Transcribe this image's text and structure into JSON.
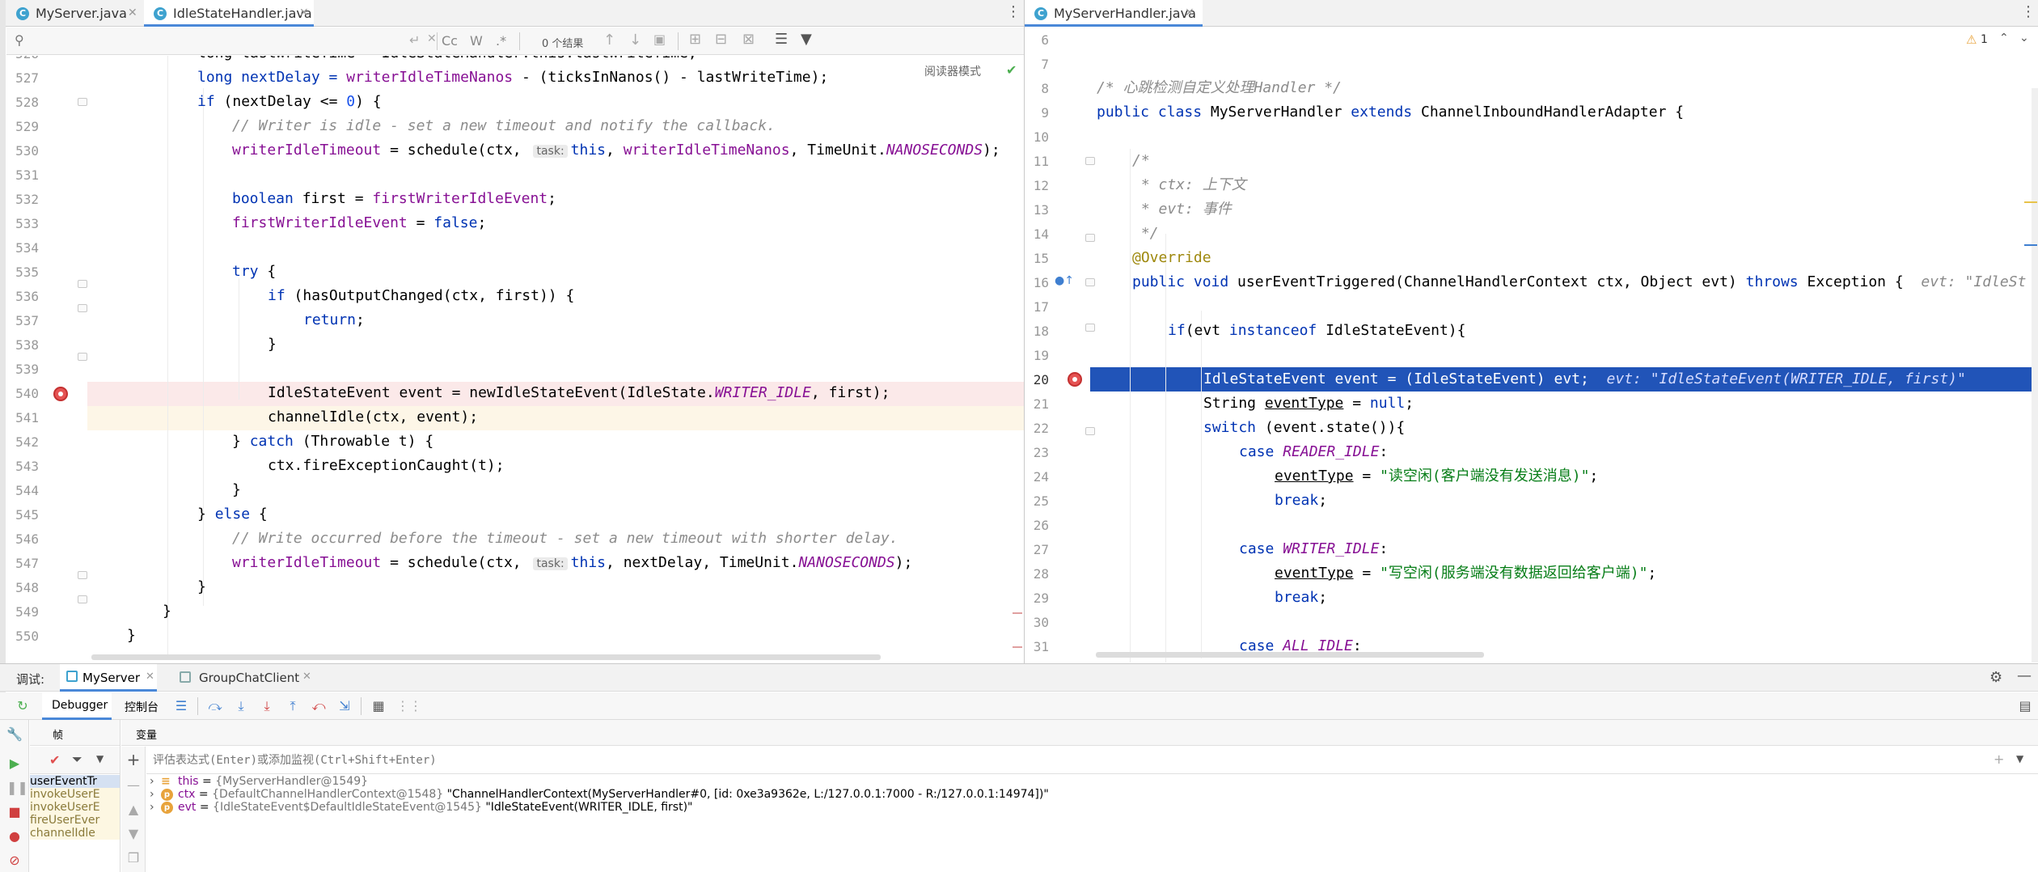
{
  "left_tabs": [
    {
      "label": "MyServer.java",
      "active": false
    },
    {
      "label": "IdleStateHandler.java",
      "active": true
    }
  ],
  "right_tabs": [
    {
      "label": "MyServerHandler.java",
      "active": true
    }
  ],
  "search": {
    "placeholder": "",
    "cc": "Cc",
    "w": "W",
    "regex": ".*",
    "results": "0 个结果"
  },
  "reader_mode": "阅读器模式",
  "warning_count": "1",
  "left_code": {
    "lines": [
      {
        "n": "526",
        "partial": true
      },
      {
        "n": "527"
      },
      {
        "n": "528"
      },
      {
        "n": "529"
      },
      {
        "n": "530"
      },
      {
        "n": "531"
      },
      {
        "n": "532"
      },
      {
        "n": "533"
      },
      {
        "n": "534"
      },
      {
        "n": "535"
      },
      {
        "n": "536"
      },
      {
        "n": "537"
      },
      {
        "n": "538"
      },
      {
        "n": "539"
      },
      {
        "n": "540"
      },
      {
        "n": "541"
      },
      {
        "n": "542"
      },
      {
        "n": "543"
      },
      {
        "n": "544"
      },
      {
        "n": "545"
      },
      {
        "n": "546"
      },
      {
        "n": "547"
      },
      {
        "n": "548"
      },
      {
        "n": "549"
      },
      {
        "n": "550"
      }
    ],
    "t526": "long lastWriteTime = IdleStateHandler.this.lastWriteTime;",
    "t527a": "long nextDelay = ",
    "t527b": "writerIdleTimeNanos",
    "t527c": " - (ticksInNanos() - lastWriteTime);",
    "t528a": "if",
    "t528b": " (nextDelay <= ",
    "t528c": "0",
    "t528d": ") {",
    "t529": "// Writer is idle - set a new timeout and notify the callback.",
    "t530a": "writerIdleTimeout",
    "t530b": " = schedule(ctx, ",
    "t530hint": "task:",
    "t530c": "this",
    "t530d": ", ",
    "t530e": "writerIdleTimeNanos",
    "t530f": ", TimeUnit.",
    "t530g": "NANOSECONDS",
    "t530h": ");",
    "t532a": "boolean",
    "t532b": " first = ",
    "t532c": "firstWriterIdleEvent",
    "t532d": ";",
    "t533a": "firstWriterIdleEvent",
    "t533b": " = ",
    "t533c": "false",
    "t533d": ";",
    "t535a": "try",
    "t535b": " {",
    "t536a": "if",
    "t536b": " (hasOutputChanged(ctx, first)) {",
    "t537a": "return",
    "t537b": ";",
    "t538": "}",
    "t540a": "IdleStateEvent event = newIdleStateEvent(IdleState.",
    "t540b": "WRITER_IDLE",
    "t540c": ", first);",
    "t541": "channelIdle(ctx, event);",
    "t542a": "} ",
    "t542b": "catch",
    "t542c": " (Throwable t) {",
    "t543": "ctx.fireExceptionCaught(t);",
    "t544": "}",
    "t545a": "} ",
    "t545b": "else",
    "t545c": " {",
    "t546": "// Write occurred before the timeout - set a new timeout with shorter delay.",
    "t547a": "writerIdleTimeout",
    "t547b": " = schedule(ctx, ",
    "t547hint": "task:",
    "t547c": "this",
    "t547d": ", nextDelay, TimeUnit.",
    "t547e": "NANOSECONDS",
    "t547f": ");",
    "t548": "}",
    "t549": "}",
    "t550": "}"
  },
  "right_code": {
    "lines": [
      {
        "n": "6"
      },
      {
        "n": "7"
      },
      {
        "n": "8"
      },
      {
        "n": "9"
      },
      {
        "n": "10"
      },
      {
        "n": "11"
      },
      {
        "n": "12"
      },
      {
        "n": "13"
      },
      {
        "n": "14"
      },
      {
        "n": "15"
      },
      {
        "n": "16"
      },
      {
        "n": "17"
      },
      {
        "n": "18"
      },
      {
        "n": "19"
      },
      {
        "n": "20"
      },
      {
        "n": "21"
      },
      {
        "n": "22"
      },
      {
        "n": "23"
      },
      {
        "n": "24"
      },
      {
        "n": "25"
      },
      {
        "n": "26"
      },
      {
        "n": "27"
      },
      {
        "n": "28"
      },
      {
        "n": "29"
      },
      {
        "n": "30"
      },
      {
        "n": "31"
      }
    ],
    "r8": "/* 心跳检测自定义处理Handler */",
    "r9a": "public class",
    "r9b": " MyServerHandler ",
    "r9c": "extends",
    "r9d": " ChannelInboundHandlerAdapter {",
    "r11": "/*",
    "r12": " * ctx: 上下文",
    "r13": " * evt: 事件",
    "r14": " */",
    "r15": "@Override",
    "r16a": "public void",
    "r16b": " userEventTriggered(ChannelHandlerContext ctx, Object evt) ",
    "r16c": "throws",
    "r16d": " Exception {",
    "r16hint": "evt: \"IdleSt",
    "r18a": "if",
    "r18b": "(evt ",
    "r18c": "instanceof",
    "r18d": " IdleStateEvent){",
    "r20a": "IdleStateEvent event = (IdleStateEvent) evt;",
    "r20hint": "evt: \"IdleStateEvent(WRITER_IDLE, first)\"",
    "r21a": "String ",
    "r21b": "eventType",
    "r21c": " = ",
    "r21d": "null",
    "r21e": ";",
    "r22a": "switch",
    "r22b": " (event.state()){",
    "r23a": "case",
    "r23b": "READER_IDLE",
    "r23c": ":",
    "r24a": "eventType",
    "r24b": " = ",
    "r24c": "\"读空闲(客户端没有发送消息)\"",
    "r24d": ";",
    "r25a": "break",
    "r25b": ";",
    "r27a": "case",
    "r27b": "WRITER_IDLE",
    "r27c": ":",
    "r28a": "eventType",
    "r28b": " = ",
    "r28c": "\"写空闲(服务端没有数据返回给客户端)\"",
    "r28d": ";",
    "r29a": "break",
    "r29b": ";",
    "r31a": "case",
    "r31b": "ALL_IDLE",
    "r31c": ":"
  },
  "debug": {
    "label": "调试:",
    "tabs": [
      {
        "label": "MyServer",
        "active": true
      },
      {
        "label": "GroupChatClient",
        "active": false
      }
    ],
    "subtabs": [
      {
        "label": "Debugger",
        "active": true
      },
      {
        "label": "控制台",
        "active": false
      }
    ],
    "frames_header": "帧",
    "vars_header": "变量",
    "eval_placeholder": "评估表达式(Enter)或添加监视(Ctrl+Shift+Enter)",
    "frames": [
      {
        "label": "userEventTr",
        "selected": true
      },
      {
        "label": "invokeUserE",
        "selected": false
      },
      {
        "label": "invokeUserE",
        "selected": false
      },
      {
        "label": "fireUserEver",
        "selected": false
      },
      {
        "label": "channelIdle",
        "selected": false
      }
    ],
    "variables": [
      {
        "name": "this",
        "eq": " = ",
        "type": "{MyServerHandler@1549}",
        "value": ""
      },
      {
        "name": "ctx",
        "eq": " = ",
        "type": "{DefaultChannelHandlerContext@1548}",
        "value": " \"ChannelHandlerContext(MyServerHandler#0, [id: 0xe3a9362e, L:/127.0.0.1:7000 - R:/127.0.0.1:14974])\""
      },
      {
        "name": "evt",
        "eq": " = ",
        "type": "{IdleStateEvent$DefaultIdleStateEvent@1545}",
        "value": " \"IdleStateEvent(WRITER_IDLE, first)\""
      }
    ]
  },
  "colors": {
    "accent": "#4a88d8",
    "selection": "#2154b8",
    "breakpoint": "#e55353"
  }
}
